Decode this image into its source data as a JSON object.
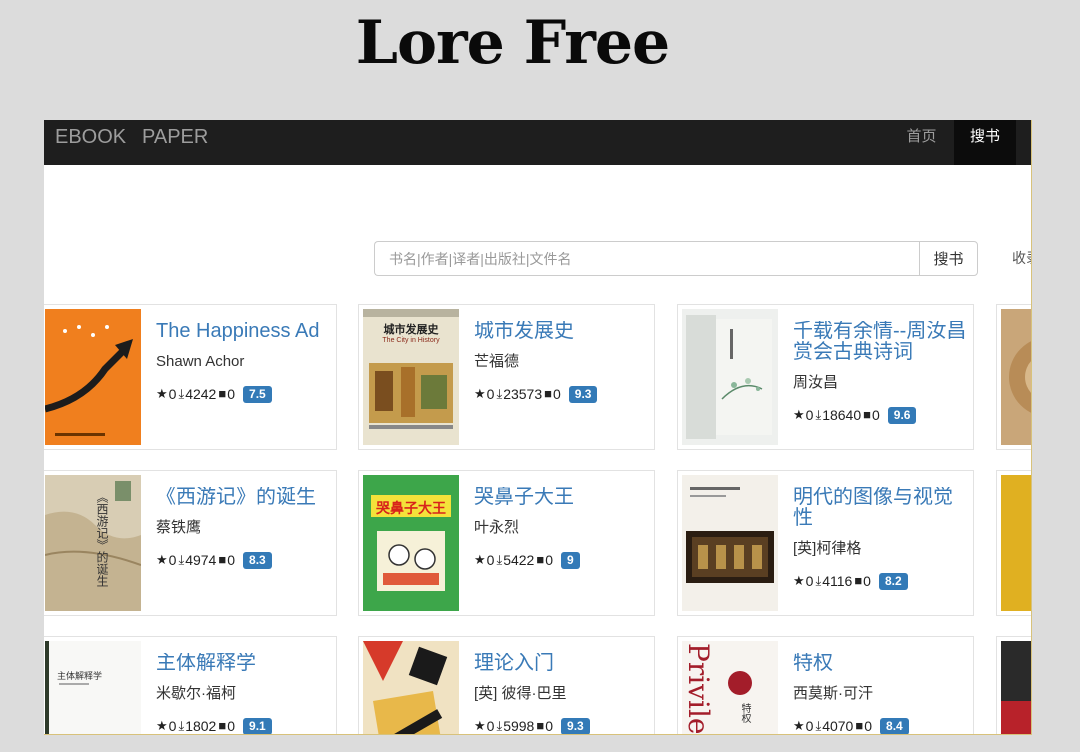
{
  "poster": {
    "title": "Lore Free"
  },
  "navbar": {
    "brand_ebook": "EBOOK",
    "brand_paper": "PAPER",
    "home": "首页",
    "search": "搜书"
  },
  "search": {
    "placeholder": "书名|作者|译者|出版社|文件名",
    "button": "搜书",
    "side_link": "收录"
  },
  "books": [
    {
      "title": "The Happiness Ad",
      "author": "Shawn Achor",
      "stars": "0",
      "downloads": "4242",
      "comments": "0",
      "score": "7.5"
    },
    {
      "title": "城市发展史",
      "author": "芒福德",
      "stars": "0",
      "downloads": "23573",
      "comments": "0",
      "score": "9.3",
      "cover_text": "城市发展史",
      "cover_sub": "The City in History"
    },
    {
      "title": "千载有余情--周汝昌赏会古典诗词",
      "author": "周汝昌",
      "stars": "0",
      "downloads": "18640",
      "comments": "0",
      "score": "9.6"
    },
    {
      "title": "《西游记》的诞生",
      "author": "蔡铁鹰",
      "stars": "0",
      "downloads": "4974",
      "comments": "0",
      "score": "8.3",
      "cover_text": "《西游记》的诞生"
    },
    {
      "title": "哭鼻子大王",
      "author": "叶永烈",
      "stars": "0",
      "downloads": "5422",
      "comments": "0",
      "score": "9",
      "cover_text": "哭鼻子大王"
    },
    {
      "title": "明代的图像与视觉性",
      "author": "[英]柯律格",
      "stars": "0",
      "downloads": "4116",
      "comments": "0",
      "score": "8.2"
    },
    {
      "title": "主体解释学",
      "author": "米歇尔·福柯",
      "stars": "0",
      "downloads": "1802",
      "comments": "0",
      "score": "9.1",
      "cover_text": "主体解释学"
    },
    {
      "title": "理论入门",
      "author": "[英] 彼得·巴里",
      "stars": "0",
      "downloads": "5998",
      "comments": "0",
      "score": "9.3"
    },
    {
      "title": "特权",
      "author": "西莫斯·可汗",
      "stars": "0",
      "downloads": "4070",
      "comments": "0",
      "score": "8.4",
      "cover_text": "Privile",
      "cover_text2": "特权"
    }
  ]
}
